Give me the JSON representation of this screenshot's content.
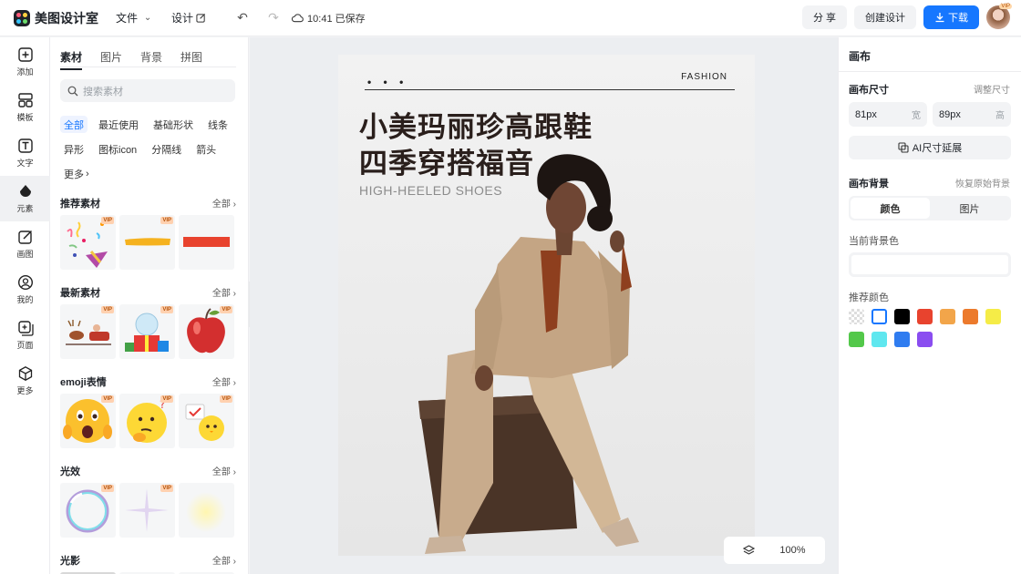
{
  "app": {
    "name": "美图设计室"
  },
  "menu": {
    "file": "文件",
    "design": "设计",
    "save_status": "10:41 已保存"
  },
  "actions": {
    "share": "分 享",
    "create": "创建设计",
    "download": "下载"
  },
  "avatar": {
    "badge": "VIP"
  },
  "rail": [
    {
      "label": "添加",
      "icon": "add-icon"
    },
    {
      "label": "模板",
      "icon": "template-icon"
    },
    {
      "label": "文字",
      "icon": "text-icon"
    },
    {
      "label": "元素",
      "icon": "element-icon"
    },
    {
      "label": "画图",
      "icon": "draw-icon"
    },
    {
      "label": "我的",
      "icon": "user-icon"
    },
    {
      "label": "页面",
      "icon": "page-icon"
    },
    {
      "label": "更多",
      "icon": "more-icon"
    }
  ],
  "panel": {
    "tabs": [
      "素材",
      "图片",
      "背景",
      "拼图"
    ],
    "search_placeholder": "搜索素材",
    "chips": [
      "全部",
      "最近使用",
      "基础形状",
      "线条",
      "异形",
      "图标icon",
      "分隔线",
      "箭头",
      "更多"
    ],
    "all_label": "全部",
    "vip": "VIP",
    "sections": [
      {
        "title": "推荐素材",
        "thumbs": [
          "party-popper",
          "yellow-brush-stroke",
          "red-bar"
        ]
      },
      {
        "title": "最新素材",
        "thumbs": [
          "reindeer-sleigh",
          "snow-globe-gift",
          "red-apple"
        ]
      },
      {
        "title": "emoji表情",
        "thumbs": [
          "shocked-emoji",
          "thinking-emoji",
          "chick-emoji"
        ]
      },
      {
        "title": "光效",
        "thumbs": [
          "bubble-ring",
          "star-sparkle",
          "soft-glow"
        ]
      },
      {
        "title": "光影",
        "thumbs": []
      }
    ]
  },
  "artboard": {
    "dots": "• • •",
    "brand": "FASHION",
    "headline_1": "小美玛丽珍高跟鞋",
    "headline_2": "四季穿搭福音",
    "subtitle": "HIGH-HEELED SHOES"
  },
  "zoom": {
    "value": "100%"
  },
  "inspector": {
    "title": "画布",
    "size_label": "画布尺寸",
    "resize_link": "调整尺寸",
    "width": "81px",
    "width_unit": "宽",
    "height": "89px",
    "height_unit": "高",
    "ai_button": "AI尺寸延展",
    "bg_label": "画布背景",
    "restore_link": "恢复原始背景",
    "seg_color": "颜色",
    "seg_image": "图片",
    "current_label": "当前背景色",
    "recommended_label": "推荐颜色",
    "swatches": [
      "transparent",
      "#ffffff",
      "#000000",
      "#e8432e",
      "#f2a54a",
      "#ec7a2c",
      "#f5ec47",
      "#53c84a",
      "#5fe7ef",
      "#2f7cf0",
      "#8a4df0"
    ]
  }
}
